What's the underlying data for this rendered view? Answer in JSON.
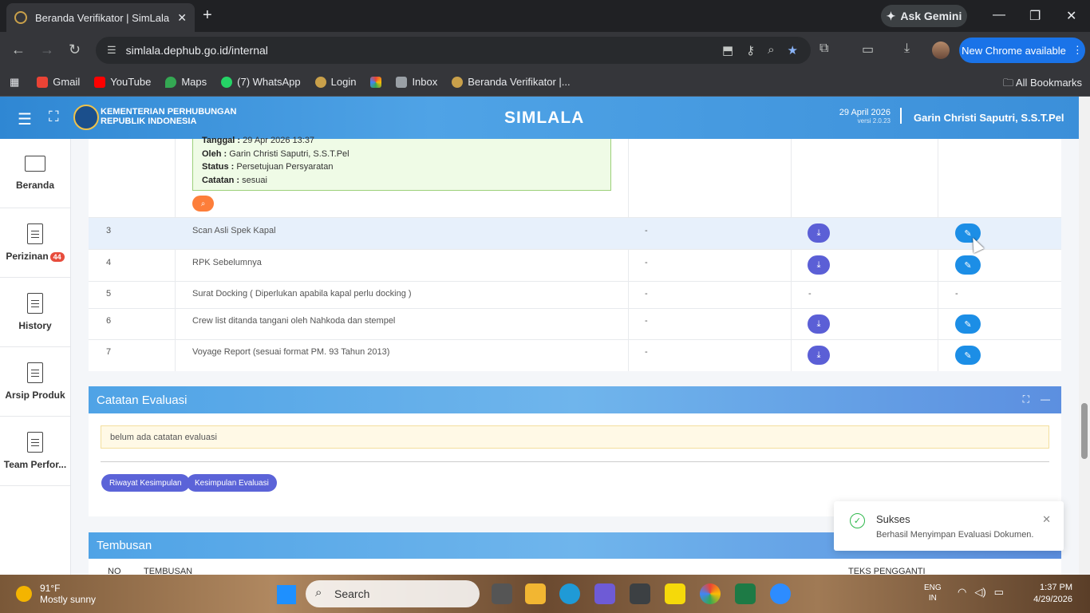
{
  "browser": {
    "tab_title": "Beranda Verifikator | SimLala",
    "tab_close": "✕",
    "new_tab": "+",
    "ask_gemini": "Ask Gemini",
    "url": "simlala.dephub.go.id/internal",
    "new_chrome": "New Chrome available",
    "bookmarks": [
      {
        "label": "Gmail",
        "color": "#ea4335"
      },
      {
        "label": "YouTube",
        "color": "#ff0000"
      },
      {
        "label": "Maps",
        "color": "#34a853"
      },
      {
        "label": "(7) WhatsApp",
        "color": "#25d366"
      },
      {
        "label": "Login",
        "color": "#c9a04a"
      },
      {
        "label": "",
        "color": "#fbbc04"
      },
      {
        "label": "Inbox",
        "color": "#9aa0a6"
      },
      {
        "label": "Beranda Verifikator |...",
        "color": "#c9a04a"
      }
    ],
    "all_bookmarks": "All Bookmarks"
  },
  "header": {
    "org_line1": "KEMENTERIAN PERHUBUNGAN",
    "org_line2": "REPUBLIK INDONESIA",
    "app_title": "SIMLALA",
    "date": "29 April 2026",
    "version": "versi 2.0.23",
    "user": "Garin Christi Saputri, S.S.T.Pel"
  },
  "sidebar": {
    "items": [
      {
        "label": "Beranda"
      },
      {
        "label": "Perizinan",
        "badge": "44"
      },
      {
        "label": "History"
      },
      {
        "label": "Arsip Produk"
      },
      {
        "label": "Team Perfor..."
      }
    ]
  },
  "table": {
    "info": {
      "tanggal_label": "Tanggal :",
      "tanggal_value": "29 Apr 2026 13:37",
      "oleh_label": "Oleh :",
      "oleh_value": "Garin Christi Saputri, S.S.T.Pel",
      "status_label": "Status :",
      "status_value": "Persetujuan Persyaratan",
      "catatan_label": "Catatan :",
      "catatan_value": "sesuai"
    },
    "rows": [
      {
        "no": "3",
        "name": "Scan Asli Spek Kapal",
        "col3": "-",
        "download": true,
        "edit": true
      },
      {
        "no": "4",
        "name": "RPK Sebelumnya",
        "col3": "-",
        "download": true,
        "edit": true
      },
      {
        "no": "5",
        "name": "Surat Docking ( Diperlukan apabila kapal perlu docking )",
        "col3": "-",
        "dl_text": "-",
        "ed_text": "-"
      },
      {
        "no": "6",
        "name": "Crew list ditanda tangani oleh Nahkoda dan stempel",
        "col3": "-",
        "download": true,
        "edit": true
      },
      {
        "no": "7",
        "name": "Voyage Report (sesuai format PM. 93 Tahun 2013)",
        "col3": "-",
        "download": true,
        "edit": true
      }
    ]
  },
  "evaluasi": {
    "title": "Catatan Evaluasi",
    "notice": "belum ada catatan evaluasi",
    "btn_riwayat": "Riwayat Kesimpulan",
    "btn_kesimpulan": "Kesimpulan Evaluasi"
  },
  "tembusan": {
    "title": "Tembusan",
    "col_no": "NO",
    "col_tembusan": "TEMBUSAN",
    "col_teks": "TEKS PENGGANTI"
  },
  "toast": {
    "title": "Sukses",
    "message": "Berhasil Menyimpan Evaluasi Dokumen."
  },
  "taskbar": {
    "temp": "91°F",
    "weather": "Mostly sunny",
    "search": "Search",
    "lang1": "ENG",
    "lang2": "IN",
    "time": "1:37 PM",
    "date": "4/29/2026"
  }
}
